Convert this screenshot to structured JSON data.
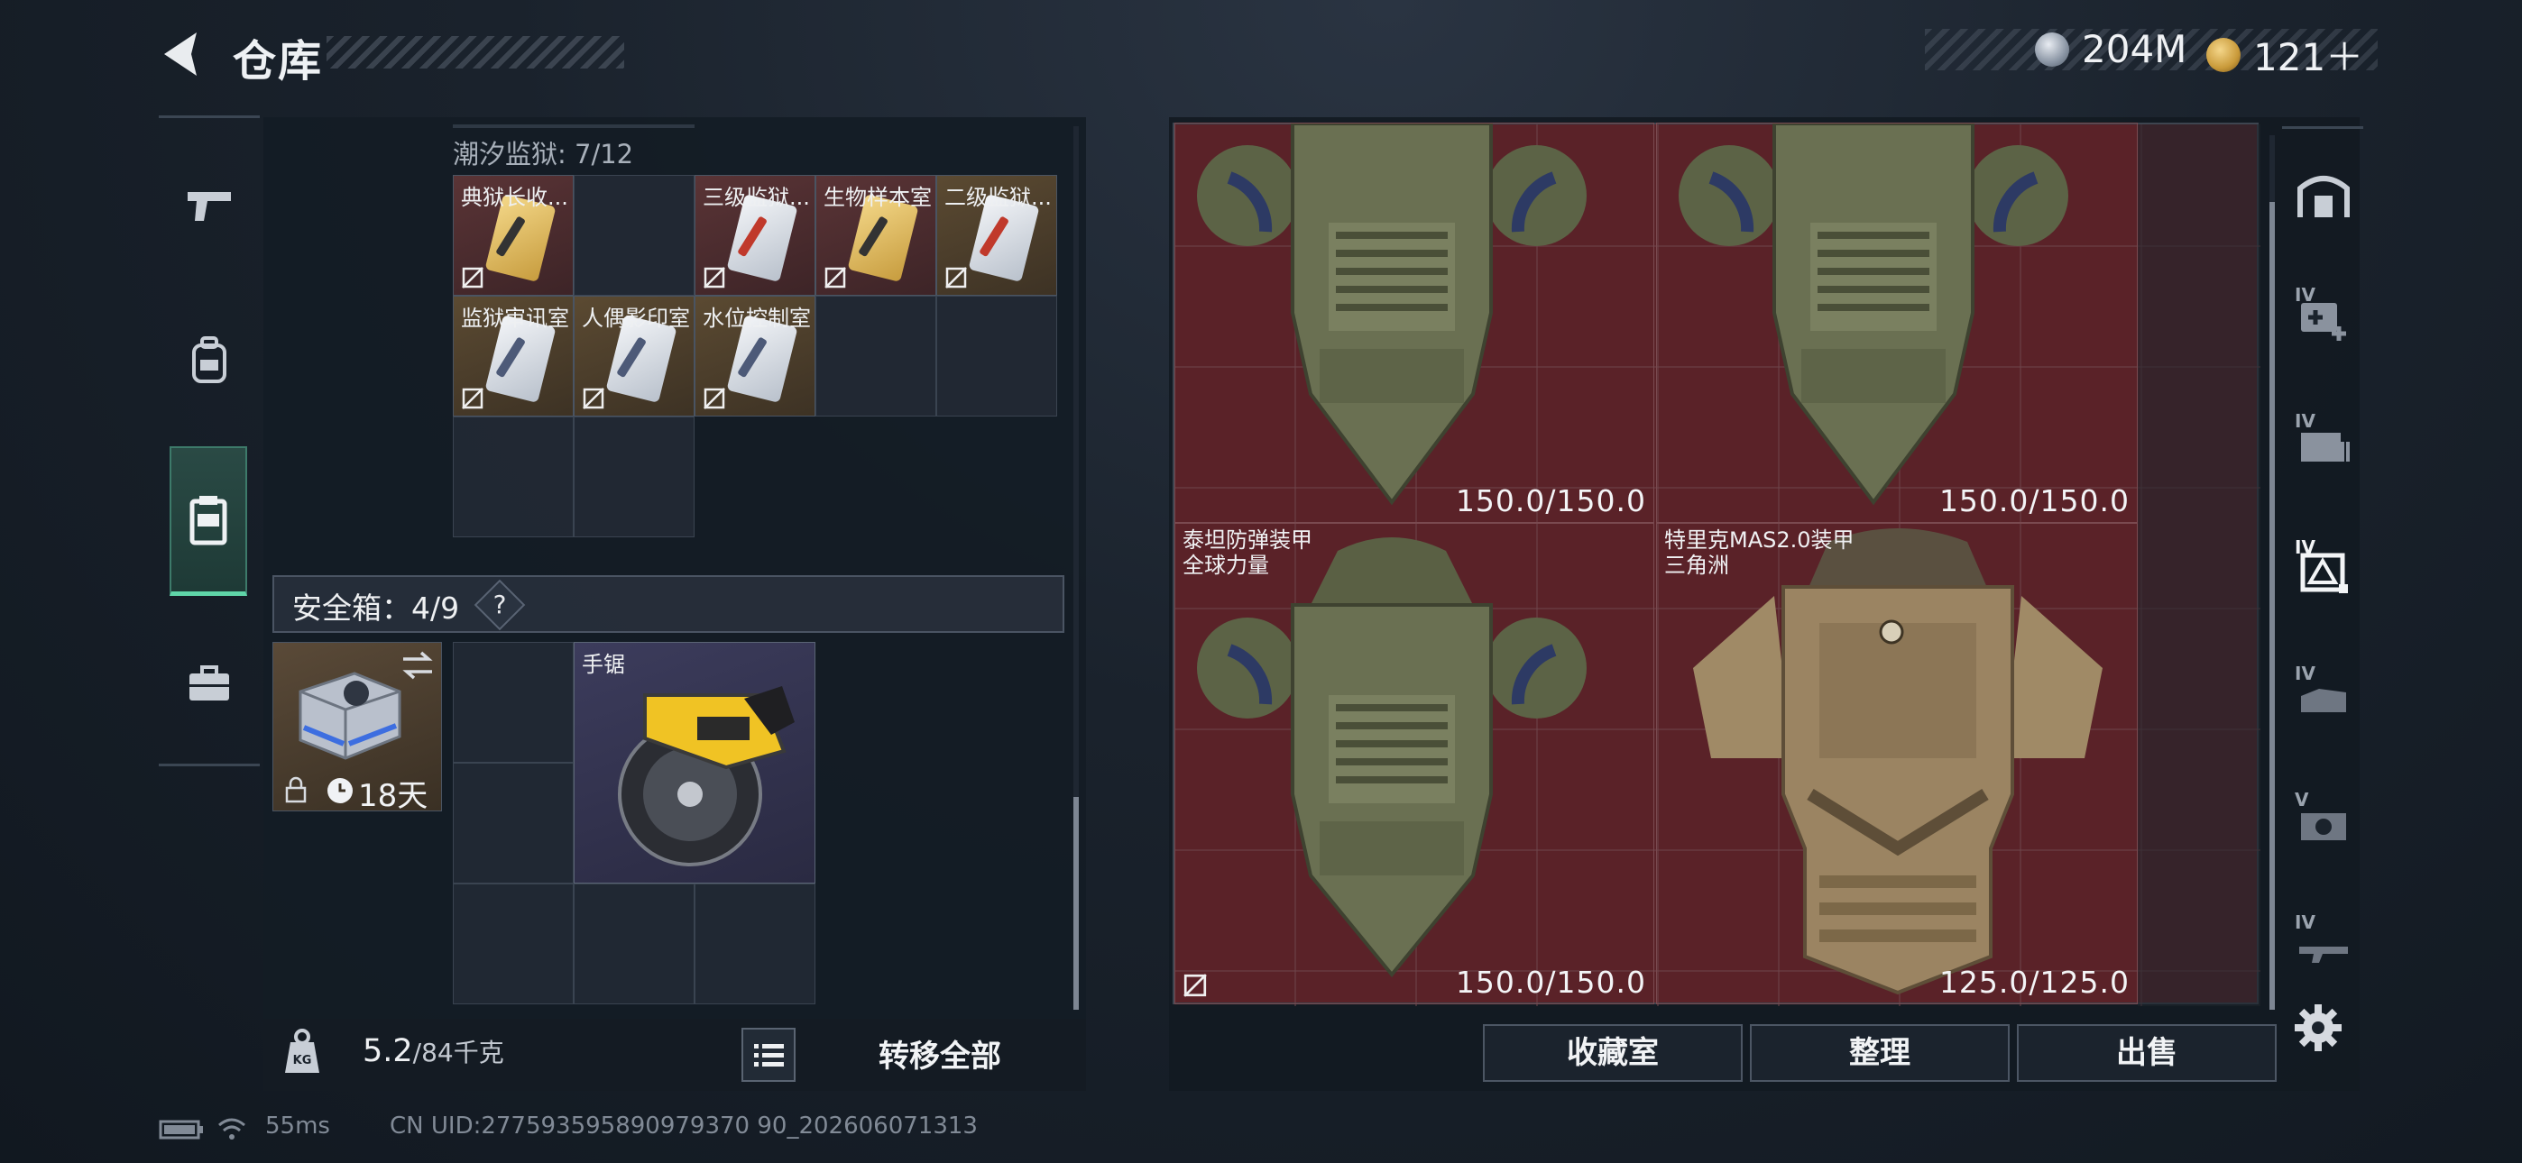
{
  "header": {
    "title": "仓库",
    "currencies": [
      {
        "name": "silver-coin-icon",
        "value": "204M"
      },
      {
        "name": "gold-coin-icon",
        "value": "121＋"
      }
    ]
  },
  "nav": {
    "items": [
      {
        "name": "weapons",
        "icon": "pistol-icon"
      },
      {
        "name": "backpack",
        "icon": "backpack-icon"
      },
      {
        "name": "container",
        "icon": "container-icon",
        "active": true
      },
      {
        "name": "toolbox",
        "icon": "briefcase-icon"
      }
    ]
  },
  "keys_section": {
    "label": "潮汐监狱: 7/12",
    "items": [
      {
        "name": "典狱长收...",
        "color": "gold"
      },
      {
        "name": "三级监狱...",
        "color": "white",
        "accent": "#c0392b"
      },
      {
        "name": "生物样本室",
        "color": "gold"
      },
      {
        "name": "二级监狱...",
        "color": "white",
        "accent": "#c0392b"
      },
      {
        "name": "监狱审讯室",
        "color": "white"
      },
      {
        "name": "人偶影印室",
        "color": "white"
      },
      {
        "name": "水位控制室",
        "color": "white"
      }
    ]
  },
  "safe_box": {
    "label": "安全箱：4/9",
    "help": "?",
    "timer": "18天",
    "item_name": "手锯"
  },
  "bottom_left": {
    "weight_value": "5.2",
    "weight_capacity": "/84千克",
    "transfer_all": "转移全部"
  },
  "stash": {
    "armors": [
      {
        "name_line1": "",
        "name_line2": "",
        "durability": "150.0/150.0",
        "camo": "green"
      },
      {
        "name_line1": "",
        "name_line2": "",
        "durability": "150.0/150.0",
        "camo": "green"
      },
      {
        "name_line1": "泰坦防弹装甲",
        "name_line2": "全球力量",
        "durability": "150.0/150.0",
        "camo": "green"
      },
      {
        "name_line1": "特里克MAS2.0装甲",
        "name_line2": "三角洲",
        "durability": "125.0/125.0",
        "camo": "desert"
      }
    ]
  },
  "right_tabs": [
    {
      "lvl": "",
      "icon": "home-icon"
    },
    {
      "lvl": "IV",
      "icon": "medkit-add-icon"
    },
    {
      "lvl": "IV",
      "icon": "ammo-box-icon"
    },
    {
      "lvl": "IV",
      "icon": "armor-case-icon",
      "active": true
    },
    {
      "lvl": "IV",
      "icon": "gear-case-icon"
    },
    {
      "lvl": "V",
      "icon": "camera-case-icon"
    },
    {
      "lvl": "IV",
      "icon": "rifle-case-icon"
    }
  ],
  "actions": {
    "collection": "收藏室",
    "sort": "整理",
    "sell": "出售"
  },
  "status": {
    "ping": "55ms",
    "uid": "CN UID:277593595890979370 90_202606071313"
  }
}
